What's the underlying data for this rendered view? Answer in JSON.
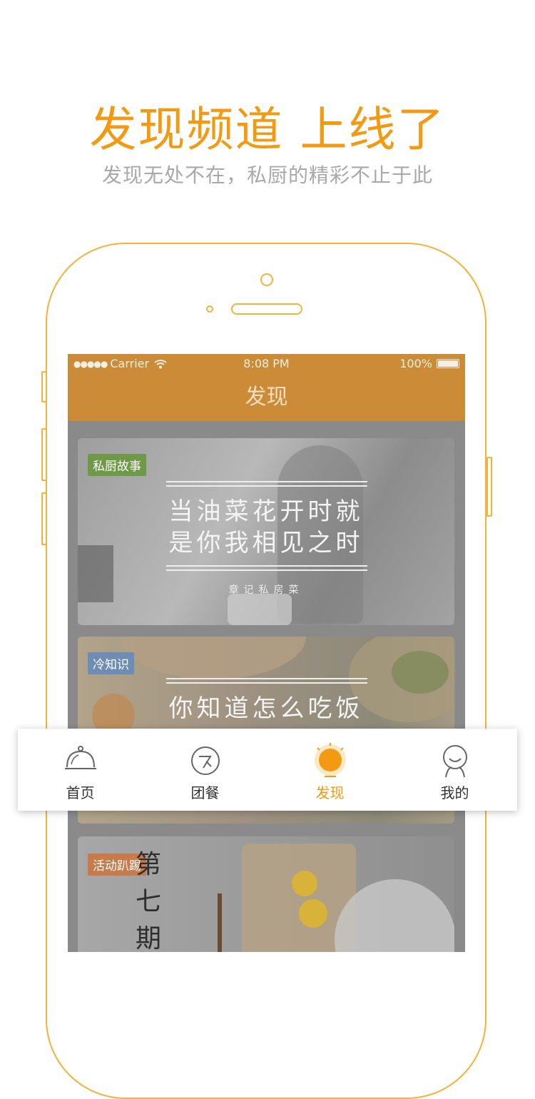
{
  "promo": {
    "headline": "发现频道 上线了",
    "subline": "发现无处不在，私厨的精彩不止于此"
  },
  "status_bar": {
    "carrier": "Carrier",
    "time": "8:08 PM",
    "battery": "100%"
  },
  "nav": {
    "title": "发现"
  },
  "cards": [
    {
      "tag": "私厨故事",
      "tag_color": "#6e9a48",
      "title_lines": [
        "当油菜花开时就",
        "是你我相见之时"
      ],
      "subtitle": "章记私房菜"
    },
    {
      "tag": "冷知识",
      "tag_color": "#6e8db6",
      "title_lines": [
        "你知道怎么吃饭"
      ],
      "subtitle": ""
    },
    {
      "tag": "活动趴踢",
      "tag_color": "#c77a4a",
      "poster_text": [
        "第",
        "七",
        "期"
      ]
    }
  ],
  "tabbar": {
    "active_color": "#f39a12",
    "tabs": [
      {
        "label": "首页",
        "icon": "cloche-icon"
      },
      {
        "label": "团餐",
        "icon": "group-meal-icon"
      },
      {
        "label": "发现",
        "icon": "sun-icon",
        "active": true
      },
      {
        "label": "我的",
        "icon": "person-icon"
      }
    ]
  },
  "colors": {
    "accent": "#f39a12",
    "nav_background": "#cc8c37",
    "phone_outline": "#f6b13b"
  }
}
